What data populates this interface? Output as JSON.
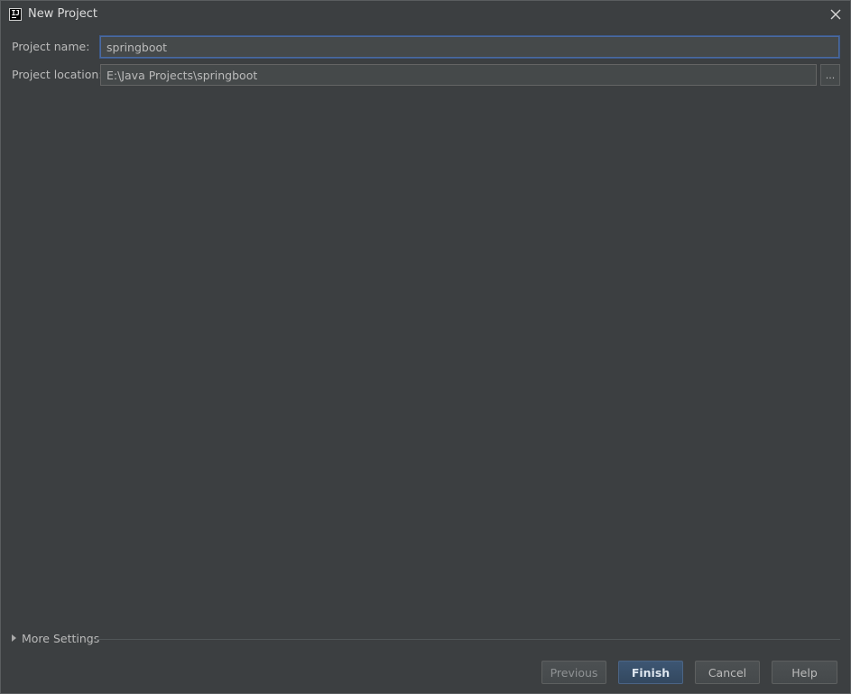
{
  "window": {
    "title": "New Project",
    "app_icon_text": "IJ"
  },
  "form": {
    "project_name": {
      "label": "Project name:",
      "value": "springboot"
    },
    "project_location": {
      "label": "Project location:",
      "value": "E:\\Java Projects\\springboot",
      "browse_label": "..."
    }
  },
  "more_settings": {
    "label": "More Settings"
  },
  "buttons": {
    "previous": "Previous",
    "finish": "Finish",
    "cancel": "Cancel",
    "help": "Help"
  },
  "colors": {
    "background": "#3c3f41",
    "input_background": "#45494a",
    "focus_border": "#4a6aa1",
    "default_button": "#3d5673"
  }
}
